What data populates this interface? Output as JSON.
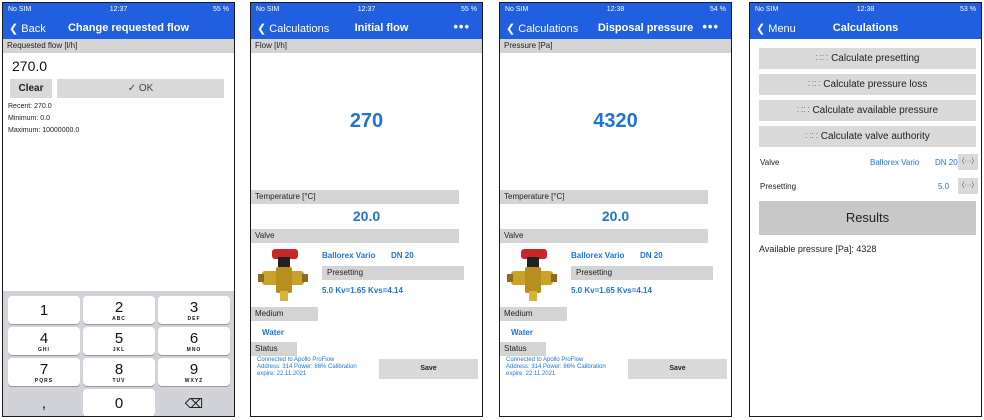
{
  "screens": [
    {
      "status": {
        "carrier": "No SIM",
        "time": "12:37",
        "battery": "55 %"
      },
      "nav": {
        "back": "Back",
        "title": "Change requested flow"
      },
      "field_label": "Requested flow [l/h]",
      "value": "270.0",
      "clear_label": "Clear",
      "ok_label": "✓ OK",
      "recent": "Recent: 270.0",
      "minimum": "Minimum: 0.0",
      "maximum": "Maximum: 10000000.0",
      "keypad": [
        {
          "digit": "1",
          "letters": ""
        },
        {
          "digit": "2",
          "letters": "ABC"
        },
        {
          "digit": "3",
          "letters": "DEF"
        },
        {
          "digit": "4",
          "letters": "GHI"
        },
        {
          "digit": "5",
          "letters": "JKL"
        },
        {
          "digit": "6",
          "letters": "MNO"
        },
        {
          "digit": "7",
          "letters": "PQRS"
        },
        {
          "digit": "8",
          "letters": "TUV"
        },
        {
          "digit": "9",
          "letters": "WXYZ"
        },
        {
          "digit": ",",
          "letters": ""
        },
        {
          "digit": "0",
          "letters": ""
        },
        {
          "digit": "⌫",
          "letters": ""
        }
      ]
    },
    {
      "status": {
        "carrier": "No SIM",
        "time": "12:37",
        "battery": "55 %"
      },
      "nav": {
        "back": "Calculations",
        "title": "Initial flow",
        "more": "•••"
      },
      "main_label": "Flow [l/h]",
      "main_value": "270",
      "temp_label": "Temperature [°C]",
      "temp_value": "20.0",
      "valve_label": "Valve",
      "valve_name": "Ballorex Vario",
      "valve_size": "DN 20",
      "presetting_label": "Presetting",
      "presetting_value": "5.0 Kv=1.65 Kvs=4.14",
      "medium_label": "Medium",
      "medium_value": "Water",
      "status_label": "Status",
      "status_lines": [
        "Connected to Apollo ProFlow",
        "Address: 314 Power: 86% Calibration",
        "expire: 22.11.2021"
      ],
      "save_label": "Save"
    },
    {
      "status": {
        "carrier": "No SIM",
        "time": "12:38",
        "battery": "54 %"
      },
      "nav": {
        "back": "Calculations",
        "title": "Disposal pressure",
        "more": "•••"
      },
      "main_label": "Pressure [Pa]",
      "main_value": "4320",
      "temp_label": "Temperature [°C]",
      "temp_value": "20.0",
      "valve_label": "Valve",
      "valve_name": "Ballorex Vario",
      "valve_size": "DN 20",
      "presetting_label": "Presetting",
      "presetting_value": "5.0 Kv=1.65 Kvs=4.14",
      "medium_label": "Medium",
      "medium_value": "Water",
      "status_label": "Status",
      "status_lines": [
        "Connected to Apollo ProFlow",
        "Address: 314 Power: 86% Calibration",
        "expire: 22.11.2021"
      ],
      "save_label": "Save"
    },
    {
      "status": {
        "carrier": "No SIM",
        "time": "12:38",
        "battery": "53 %"
      },
      "nav": {
        "back": "Menu",
        "title": "Calculations"
      },
      "buttons": [
        "Calculate presetting",
        "Calculate pressure loss",
        "Calculate available pressure",
        "Calculate valve authority"
      ],
      "valve_label": "Valve",
      "valve_value": "Ballorex Vario",
      "valve_size": "DN 20",
      "presetting_label": "Presetting",
      "presetting_value": "5.0",
      "swap_icon": "⟨···⟩",
      "results_label": "Results",
      "result_text": "Available pressure [Pa]: 4328"
    }
  ]
}
